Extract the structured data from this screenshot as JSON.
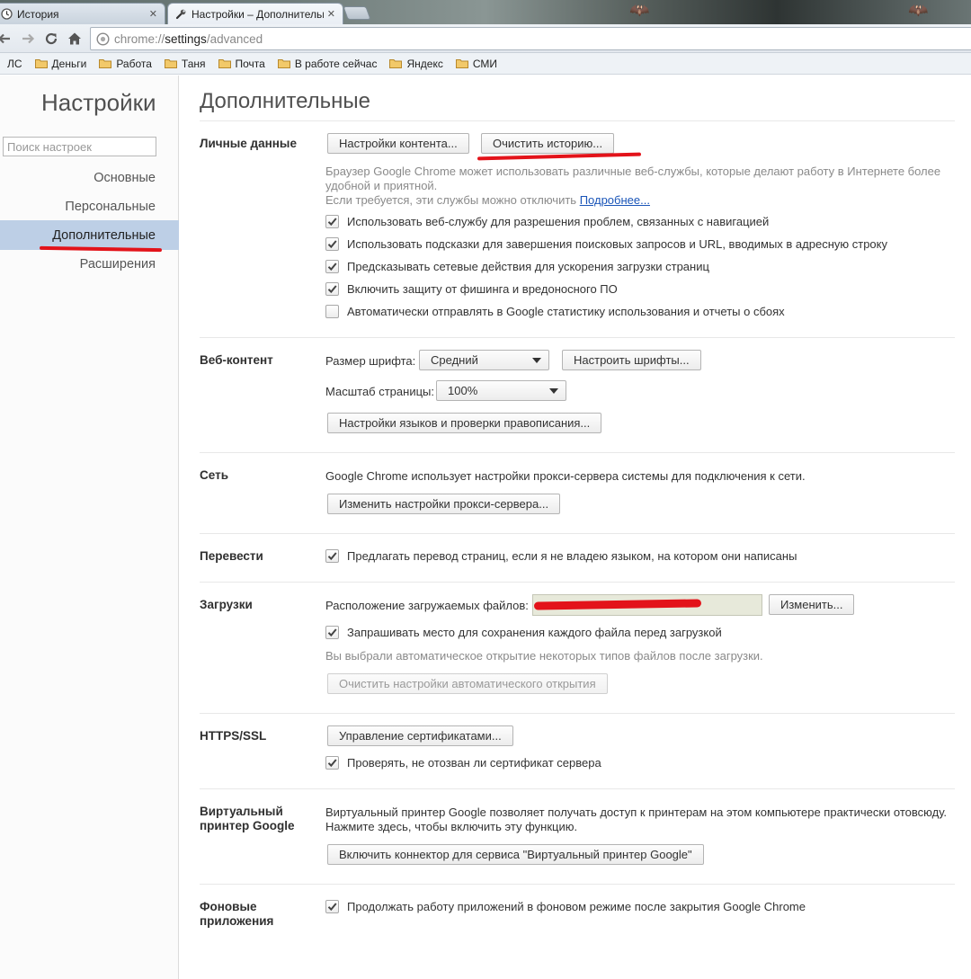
{
  "browser": {
    "tabs": [
      {
        "title": "История",
        "icon": "clock-icon",
        "close": "✕"
      },
      {
        "title": "Настройки – Дополнительные",
        "icon": "wrench-icon",
        "close": "✕"
      }
    ],
    "url": {
      "scheme": "chrome://",
      "host": "settings",
      "path": "/advanced"
    },
    "bookmarks": [
      "ЛС",
      "Деньги",
      "Работа",
      "Таня",
      "Почта",
      "В работе сейчас",
      "Яндекс",
      "СМИ"
    ]
  },
  "sidebar": {
    "title": "Настройки",
    "search_placeholder": "Поиск настроек",
    "items": [
      "Основные",
      "Персональные",
      "Дополнительные",
      "Расширения"
    ]
  },
  "main": {
    "title": "Дополнительные",
    "privacy": {
      "title": "Личные данные",
      "content_settings_btn": "Настройки контента...",
      "clear_history_btn": "Очистить историю...",
      "desc_line1": "Браузер Google Chrome может использовать различные веб-службы, которые делают работу в Интернете более",
      "desc_line2": "удобной и приятной.",
      "desc_line3": "Если требуется, эти службы можно отключить",
      "learn_more": "Подробнее...",
      "checkboxes": [
        {
          "label": "Использовать веб-службу для разрешения проблем, связанных с навигацией",
          "checked": true
        },
        {
          "label": "Использовать подсказки для завершения поисковых запросов и URL, вводимых в адресную строку",
          "checked": true
        },
        {
          "label": "Предсказывать сетевые действия для ускорения загрузки страниц",
          "checked": true
        },
        {
          "label": "Включить защиту от фишинга и вредоносного ПО",
          "checked": true
        },
        {
          "label": "Автоматически отправлять в Google статистику использования и отчеты о сбоях",
          "checked": false
        }
      ]
    },
    "web_content": {
      "title": "Веб-контент",
      "font_size_label": "Размер шрифта:",
      "font_size_value": "Средний",
      "customize_fonts_btn": "Настроить шрифты...",
      "zoom_label": "Масштаб страницы:",
      "zoom_value": "100%",
      "languages_btn": "Настройки языков и проверки правописания..."
    },
    "network": {
      "title": "Сеть",
      "desc": "Google Chrome использует настройки прокси-сервера системы для подключения к сети.",
      "proxy_btn": "Изменить настройки прокси-сервера..."
    },
    "translate": {
      "title": "Перевести",
      "checkbox": {
        "label": "Предлагать перевод страниц, если я не владею языком, на котором они написаны",
        "checked": true
      }
    },
    "downloads": {
      "title": "Загрузки",
      "location_label": "Расположение загружаемых файлов:",
      "change_btn": "Изменить...",
      "checkbox": {
        "label": "Запрашивать место для сохранения каждого файла перед загрузкой",
        "checked": true
      },
      "auto_open_desc": "Вы выбрали автоматическое открытие некоторых типов файлов после загрузки.",
      "clear_auto_open_btn": "Очистить настройки автоматического открытия"
    },
    "https": {
      "title": "HTTPS/SSL",
      "manage_certs_btn": "Управление сертификатами...",
      "checkbox": {
        "label": "Проверять, не отозван ли сертификат сервера",
        "checked": true
      }
    },
    "cloud_print": {
      "title_line1": "Виртуальный",
      "title_line2": "принтер Google",
      "desc_line1": "Виртуальный принтер Google позволяет получать доступ к принтерам на этом компьютере практически отовсюду.",
      "desc_line2": "Нажмите здесь, чтобы включить эту функцию.",
      "enable_btn": "Включить коннектор для сервиса \"Виртуальный принтер Google\""
    },
    "background_apps": {
      "title_line1": "Фоновые",
      "title_line2": "приложения",
      "checkbox": {
        "label": "Продолжать работу приложений в фоновом режиме после закрытия Google Chrome",
        "checked": true
      }
    }
  },
  "colors": {
    "annotation_red": "#e3131a",
    "active_nav_bg": "#bdcfe6",
    "link": "#1a55b8"
  }
}
